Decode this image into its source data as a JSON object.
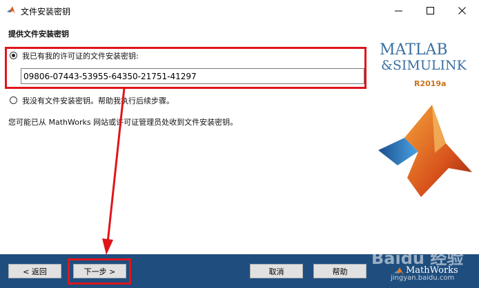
{
  "window": {
    "title": "文件安装密钥",
    "controls": {
      "minimize_icon": "minimize-icon",
      "maximize_icon": "maximize-icon",
      "close_icon": "close-icon"
    }
  },
  "section_title": "提供文件安装密钥",
  "options": {
    "have_key": {
      "label": "我已有我的许可证的文件安装密钥:",
      "selected": true
    },
    "no_key": {
      "label": "我没有文件安装密钥。帮助我执行后续步骤。",
      "selected": false
    }
  },
  "key_input": {
    "value": "09806-07443-53955-64350-21751-41297"
  },
  "info_text": "您可能已从 MathWorks 网站或许可证管理员处收到文件安装密钥。",
  "branding": {
    "line1": "MATLAB",
    "line2": "&SIMULINK",
    "release": "R2019a"
  },
  "buttons": {
    "back": "< 返回",
    "next": "下一步 >",
    "cancel": "取消",
    "help": "帮助"
  },
  "footer": {
    "brand": "MathWorks",
    "watermark": "Baidu 经验",
    "watermark_sub": "jingyan.baidu.com"
  },
  "colors": {
    "accent_red": "#e0141b",
    "bottom_bar": "#1f4e7e",
    "logo_blue": "#3a6fa2"
  }
}
